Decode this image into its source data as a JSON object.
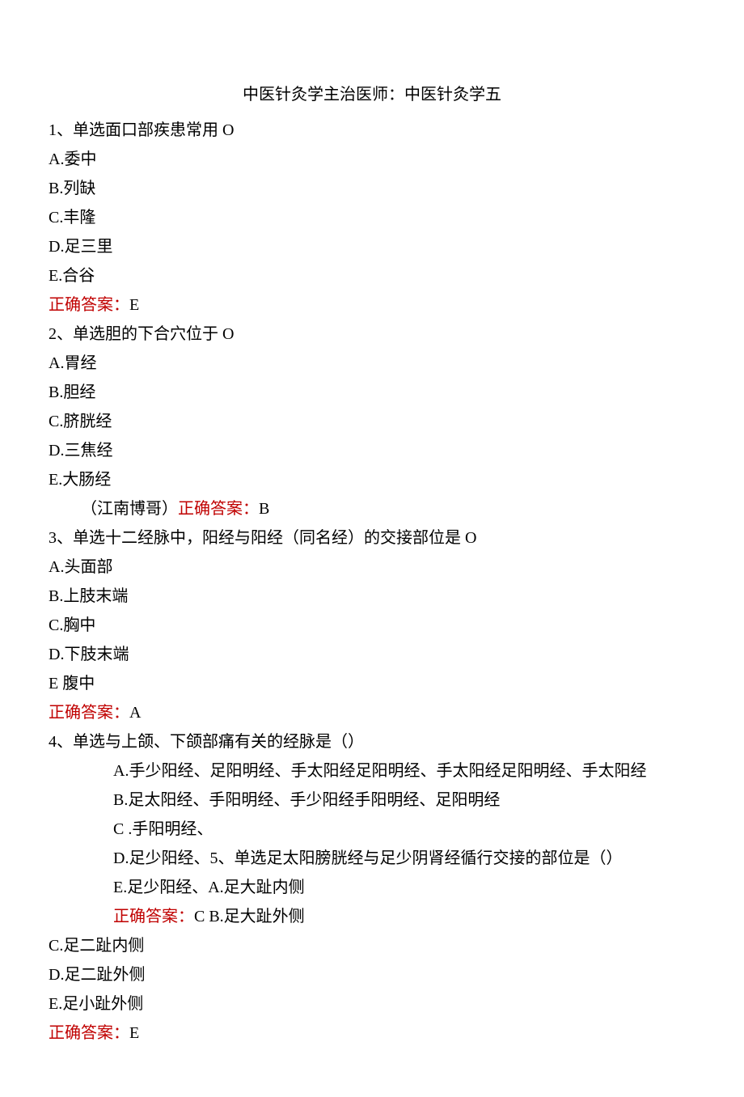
{
  "title": "中医针灸学主治医师：中医针灸学五",
  "q1": {
    "stem": "1、单选面口部疾患常用 O",
    "a": "A.委中",
    "b": "B.列缺",
    "c": "C.丰隆",
    "d": "D.足三里",
    "e": "E.合谷",
    "ans_label": "正确答案：",
    "ans_value": "E"
  },
  "q2": {
    "stem": "2、单选胆的下合穴位于 O",
    "a": "A.胃经",
    "b": "B.胆经",
    "c": "C.脐胱经",
    "d": "D.三焦经",
    "e": "E.大肠经",
    "prefix": "（江南博哥）",
    "ans_label": "正确答案：",
    "ans_value": "B"
  },
  "q3": {
    "stem": "3、单选十二经脉中，阳经与阳经（同名经）的交接部位是 O",
    "a": "A.头面部",
    "b": "B.上肢末端",
    "c": "C.胸中",
    "d": "D.下肢末端",
    "e": "E 腹中",
    "ans_label": "正确答案：",
    "ans_value": "A"
  },
  "q4": {
    "stem": "4、单选与上颌、下颌部痛有关的经脉是（）",
    "a": "A.手少阳经、足阳明经、手太阳经足阳明经、手太阳经足阳明经、手太阳经",
    "b": "B.足太阳经、手阳明经、手少阳经手阳明经、足阳明经",
    "c": "C .手阳明经、",
    "d": "D.足少阳经、5、单选足太阳膀胱经与足少阴肾经循行交接的部位是（）",
    "e": "E.足少阳经、",
    "ans_label": "正确答案：",
    "ans_value": "C"
  },
  "q5": {
    "a": "A.足大趾内侧",
    "b": "B.足大趾外侧",
    "c": "C.足二趾内侧",
    "d": "D.足二趾外侧",
    "e": "E.足小趾外侧",
    "ans_label": "正确答案：",
    "ans_value": "E"
  }
}
